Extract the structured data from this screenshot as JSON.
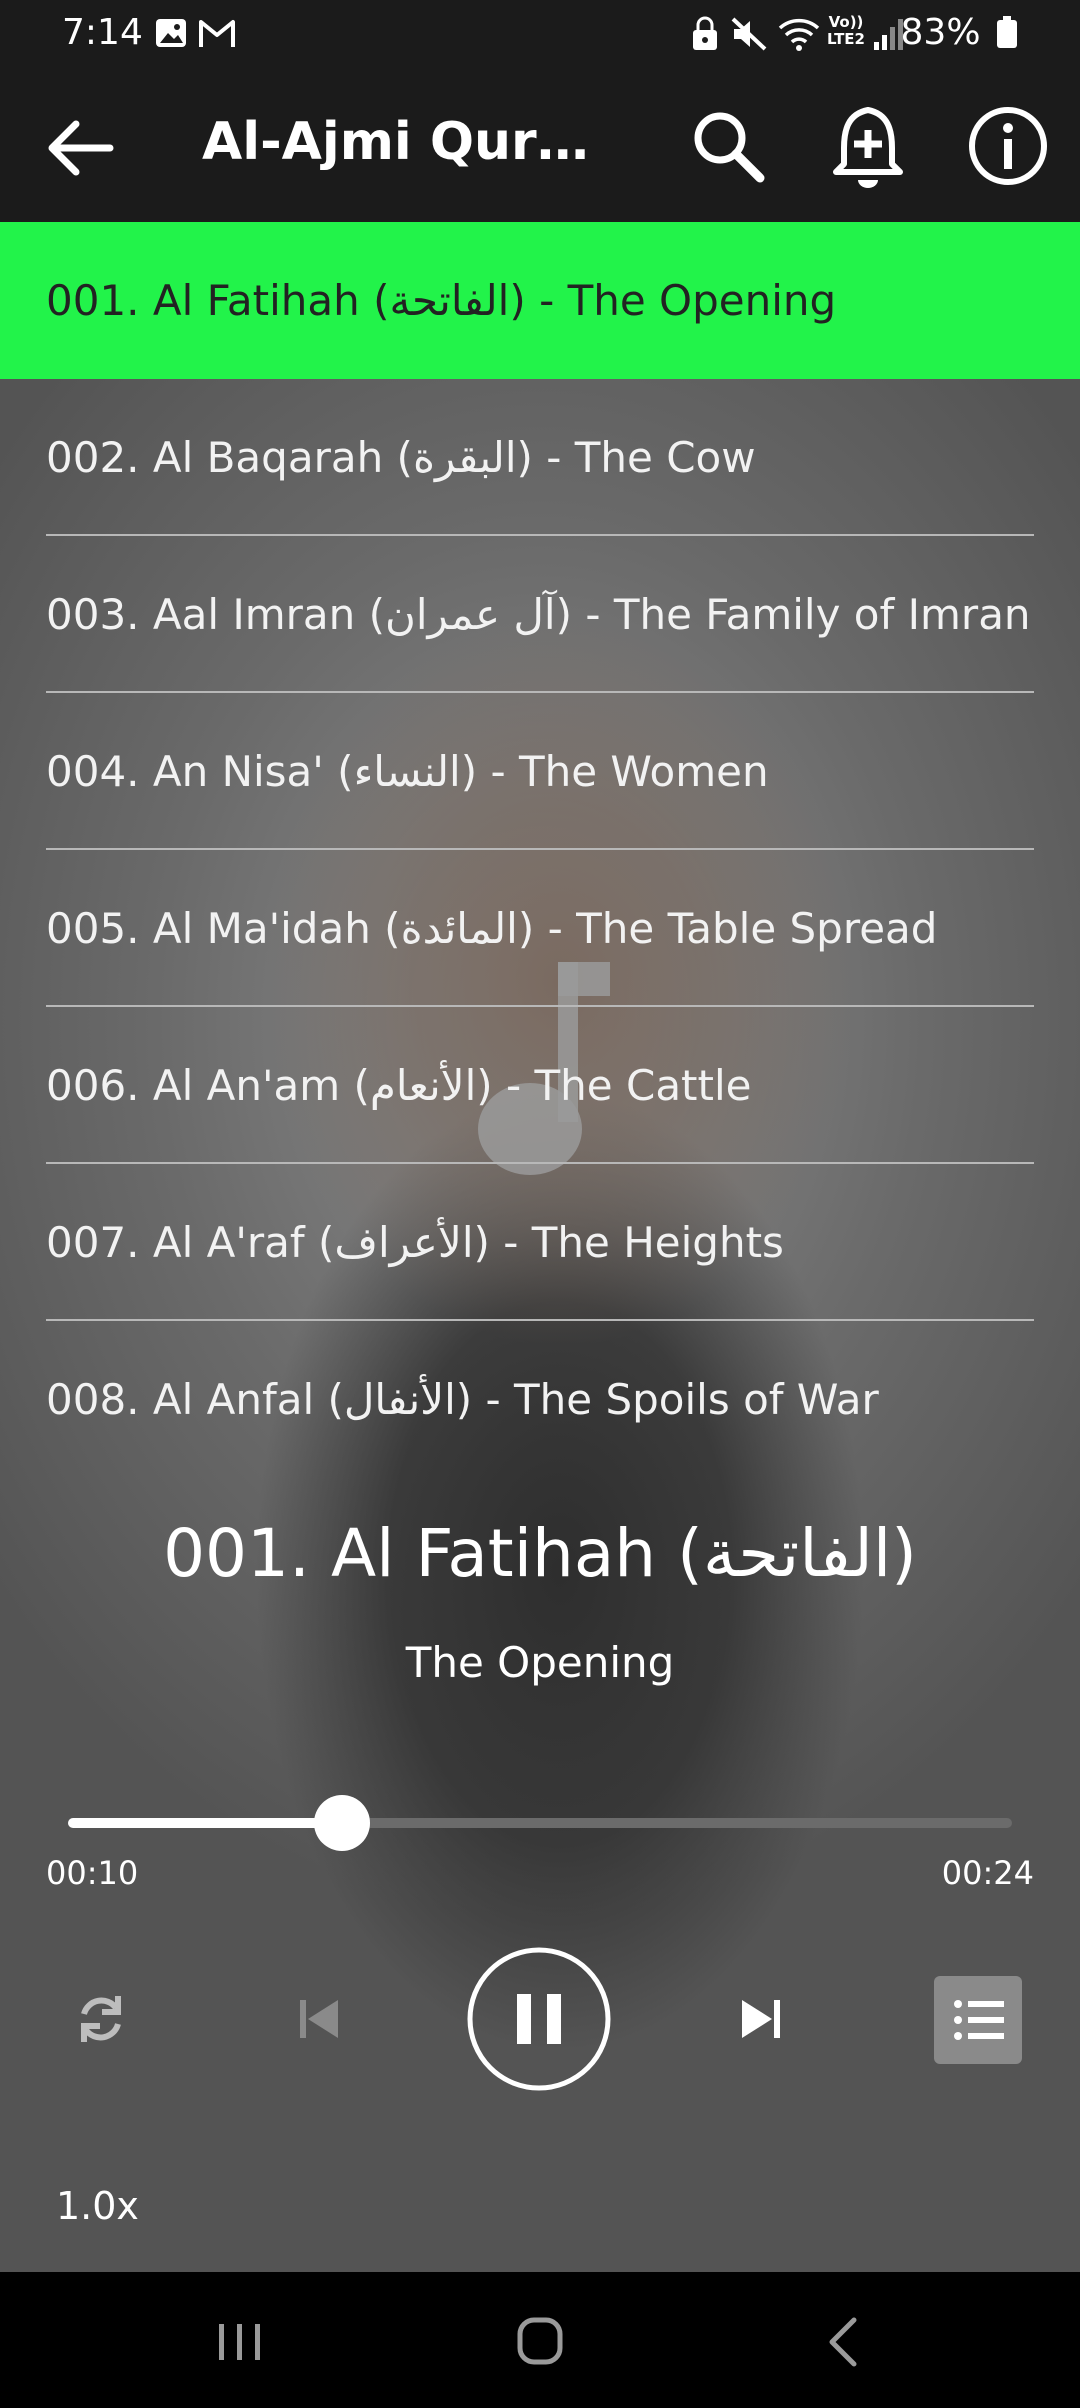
{
  "status_bar": {
    "time": "7:14",
    "battery": "83%",
    "icons": [
      "gallery-icon",
      "gmail-icon",
      "lock-icon",
      "mute-icon",
      "wifi-icon",
      "volte-icon",
      "signal-icon",
      "battery-icon"
    ],
    "volte_label": "Vo)) LTE2"
  },
  "app_bar": {
    "title": "Al-Ajmi Quran...",
    "icons": [
      "back-arrow-icon",
      "search-icon",
      "add-alarm-icon",
      "info-icon"
    ]
  },
  "tracks": [
    {
      "label": "001. Al Fatihah (الفاتحة) - The Opening",
      "active": true
    },
    {
      "label": "002. Al Baqarah (البقرة) - The Cow",
      "active": false
    },
    {
      "label": "003. Aal Imran (آل عمران) - The Family of Imran",
      "active": false
    },
    {
      "label": "004. An Nisa' (النساء) - The Women",
      "active": false
    },
    {
      "label": "005. Al Ma'idah (المائدة) - The Table Spread",
      "active": false
    },
    {
      "label": "006. Al An'am (الأنعام) - The Cattle",
      "active": false
    },
    {
      "label": "007. Al A'raf (الأعراف) - The Heights",
      "active": false
    },
    {
      "label": "008. Al Anfal (الأنفال) - The Spoils of War",
      "active": false
    }
  ],
  "now_playing": {
    "title": "001. Al Fatihah (الفاتحة)",
    "subtitle": "The Opening"
  },
  "player": {
    "current_time": "00:10",
    "total_time": "00:24",
    "progress_fraction": 0.29,
    "speed": "1.0x",
    "accent_color": "#22f34a"
  },
  "nav_bar": {
    "icons": [
      "recent-apps-icon",
      "home-icon",
      "back-icon"
    ]
  }
}
